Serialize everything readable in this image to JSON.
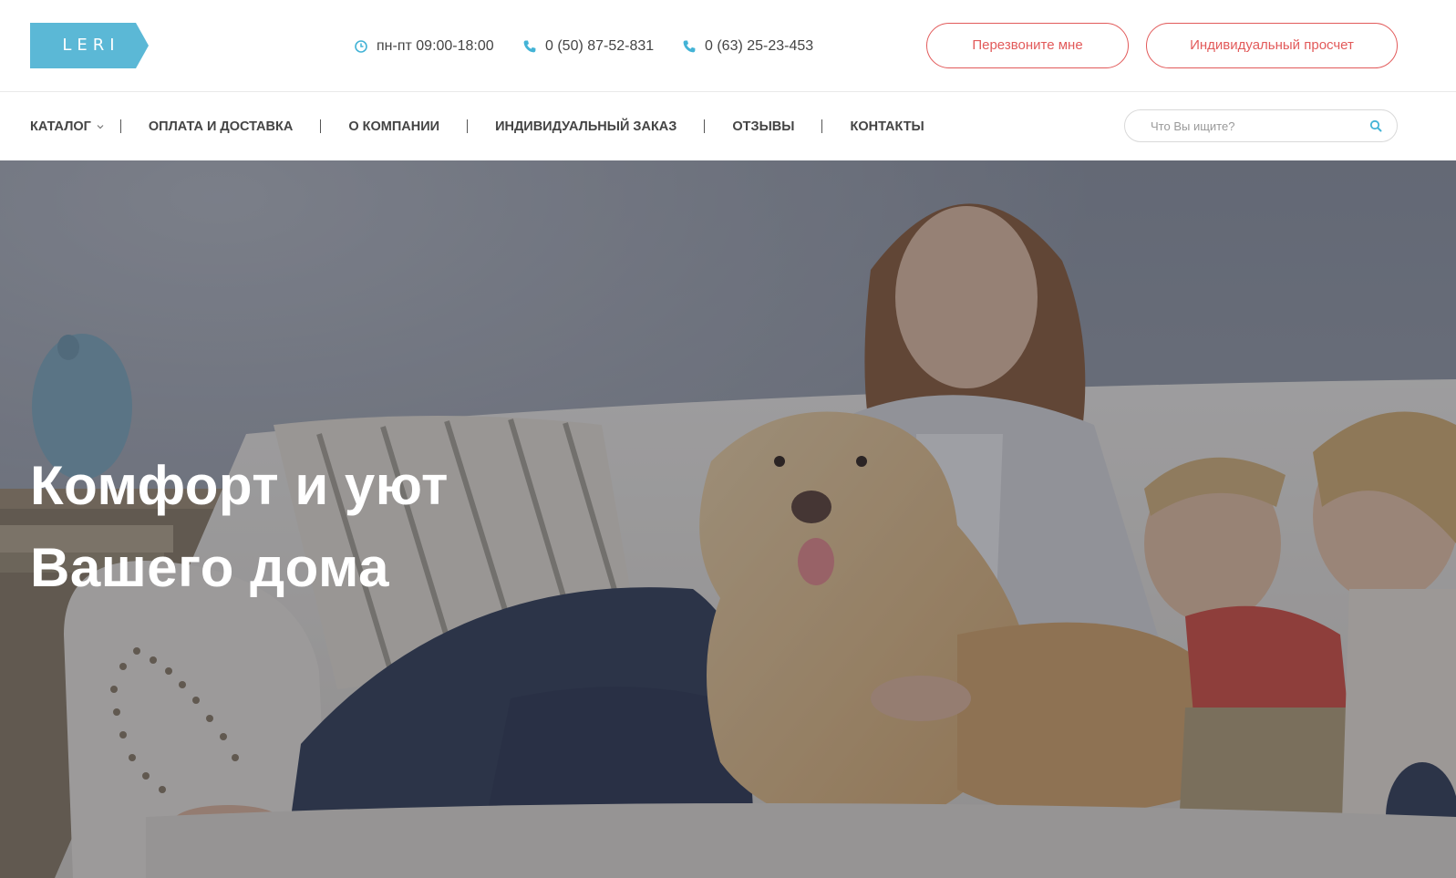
{
  "header": {
    "logo_text": "LERI",
    "hours": "пн-пт 09:00-18:00",
    "phones": [
      "0 (50) 87-52-831",
      "0 (63) 25-23-453"
    ],
    "callback_button": "Перезвоните мне",
    "calc_button": "Индивидуальный просчет",
    "icons": {
      "hours": "clock-icon",
      "phone": "phone-icon"
    }
  },
  "nav": {
    "items": [
      "КАТАЛОГ",
      "ОПЛАТА И ДОСТАВКА",
      "О КОМПАНИИ",
      "ИНДИВИДУАЛЬНЫЙ ЗАКАЗ",
      "ОТЗЫВЫ",
      "КОНТАКТЫ"
    ],
    "catalog_has_dropdown": true
  },
  "search": {
    "placeholder": "Что Вы ищите?",
    "value": "",
    "icon": "search-icon"
  },
  "hero": {
    "title_line1": "Комфорт и уют",
    "title_line2": "Вашего дома",
    "image": "family-with-dog-on-sofa"
  },
  "colors": {
    "logo_bg": "#5bb8d6",
    "accent_blue": "#43b3d6",
    "button_red": "#e25a5a",
    "nav_text": "#444444"
  }
}
